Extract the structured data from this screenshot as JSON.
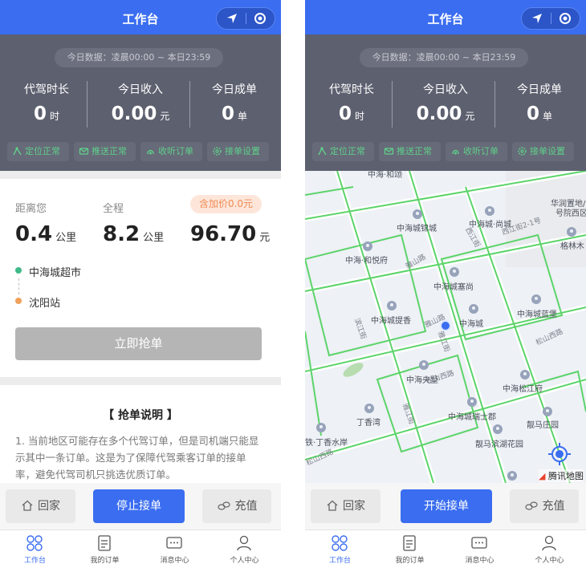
{
  "left": {
    "header": {
      "title": "工作台"
    },
    "stats": {
      "date_range": "今日数据：凌晨00:00 ~ 本日23:59",
      "items": [
        {
          "label": "代驾时长",
          "value": "0",
          "unit": "时"
        },
        {
          "label": "今日收入",
          "value": "0.00",
          "unit": "元"
        },
        {
          "label": "今日成单",
          "value": "0",
          "unit": "单"
        }
      ],
      "status": [
        {
          "label": "定位正常",
          "icon": "location-check-icon"
        },
        {
          "label": "推送正常",
          "icon": "push-icon"
        },
        {
          "label": "收听订单",
          "icon": "headset-icon"
        },
        {
          "label": "接单设置",
          "icon": "gear-icon"
        }
      ]
    },
    "order": {
      "distance_label": "距离您",
      "distance_value": "0.4",
      "distance_unit": "公里",
      "trip_label": "全程",
      "trip_value": "8.2",
      "trip_unit": "公里",
      "markup_badge": "含加价0.0元",
      "price_value": "96.70",
      "price_unit": "元",
      "from": "中海城超市",
      "to": "沈阳站",
      "grab_button": "立即抢单"
    },
    "notes": {
      "title": "【 抢单说明 】",
      "body": "1. 当前地区可能存在多个代驾订单，但是司机端只能显示其中一条订单。这是为了保障代驾乘客订单的接单率，避免代驾司机只挑选优质订单。"
    },
    "actions": {
      "home": "回家",
      "toggle": "停止接单",
      "recharge": "充值"
    }
  },
  "right": {
    "header": {
      "title": "工作台"
    },
    "stats": {
      "date_range": "今日数据：凌晨00:00 ~ 本日23:59",
      "items": [
        {
          "label": "代驾时长",
          "value": "0",
          "unit": "时"
        },
        {
          "label": "今日收入",
          "value": "0.00",
          "unit": "元"
        },
        {
          "label": "今日成单",
          "value": "0",
          "unit": "单"
        }
      ],
      "status": [
        {
          "label": "定位正常",
          "icon": "location-check-icon"
        },
        {
          "label": "推送正常",
          "icon": "push-icon"
        },
        {
          "label": "收听订单",
          "icon": "headset-icon"
        },
        {
          "label": "接单设置",
          "icon": "gear-icon"
        }
      ]
    },
    "map": {
      "pois": [
        "中海·和颂",
        "华润置地/",
        "号院西区",
        "中海城锦城",
        "中海城·尚城",
        "格林木",
        "中海·和悦府",
        "中海城塞尚",
        "中海城提香",
        "中海城",
        "中海城蓝堡",
        "中海央墅",
        "中海松江府",
        "中海城瑞士郡",
        "靓马庄园",
        "丁香湾",
        "靓马滨湖花园",
        "铁·丁香水岸"
      ],
      "roads": [
        "西江街",
        "西江街2-1号",
        "雅山路",
        "滨江街",
        "雅山路",
        "雅江街",
        "松山西路",
        "松山西路",
        "雅江街",
        "松山西路"
      ],
      "logo": "腾讯地图"
    },
    "actions": {
      "home": "回家",
      "toggle": "开始接单",
      "recharge": "充值"
    }
  },
  "tabs": [
    {
      "label": "工作台",
      "icon": "grid-icon",
      "active": true
    },
    {
      "label": "我的订单",
      "icon": "order-icon",
      "active": false
    },
    {
      "label": "消息中心",
      "icon": "message-icon",
      "active": false
    },
    {
      "label": "个人中心",
      "icon": "user-icon",
      "active": false
    }
  ],
  "colors": {
    "primary": "#3a6df0",
    "panel": "#5d606f",
    "status_green": "#5fd08b",
    "road_green": "#5cd46a",
    "badge_orange": "#f08a55",
    "disabled_gray": "#b5b5b5"
  }
}
